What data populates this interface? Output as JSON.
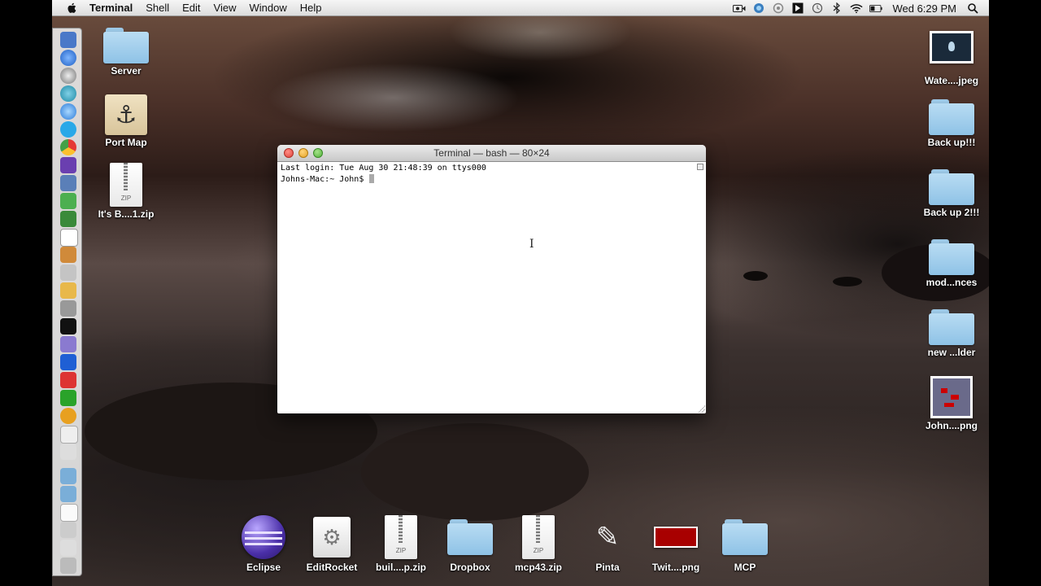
{
  "menubar": {
    "app": "Terminal",
    "menus": [
      "Shell",
      "Edit",
      "View",
      "Window",
      "Help"
    ],
    "clock": "Wed 6:29 PM",
    "status_icons": [
      "camera-icon",
      "network-icon",
      "sync-icon",
      "flag-icon",
      "time-machine-icon",
      "bluetooth-icon",
      "wifi-icon",
      "battery-icon",
      "spotlight-icon"
    ]
  },
  "desktop_left": [
    {
      "label": "Server",
      "kind": "folder"
    },
    {
      "label": "Port Map",
      "kind": "image-anchor"
    },
    {
      "label": "It's B....1.zip",
      "kind": "zip"
    }
  ],
  "desktop_right": [
    {
      "label": "Wate....jpeg",
      "kind": "image"
    },
    {
      "label": "Back up!!!",
      "kind": "folder"
    },
    {
      "label": "Back up 2!!!",
      "kind": "folder"
    },
    {
      "label": "mod...nces",
      "kind": "folder"
    },
    {
      "label": "new ...lder",
      "kind": "folder"
    },
    {
      "label": "John....png",
      "kind": "image"
    }
  ],
  "terminal": {
    "title": "Terminal — bash — 80×24",
    "lines": [
      "Last login: Tue Aug 30 21:48:39 on ttys000",
      "Johns-Mac:~ John$ "
    ]
  },
  "bottom_items": [
    {
      "label": "Eclipse"
    },
    {
      "label": "EditRocket"
    },
    {
      "label": "buil....p.zip"
    },
    {
      "label": "Dropbox"
    },
    {
      "label": "mcp43.zip"
    },
    {
      "label": "Pinta"
    },
    {
      "label": "Twit....png"
    },
    {
      "label": "MCP"
    }
  ],
  "zip_badge": "ZIP",
  "colors": {
    "accent": "#a80000",
    "folder": "#8ec2e6"
  }
}
